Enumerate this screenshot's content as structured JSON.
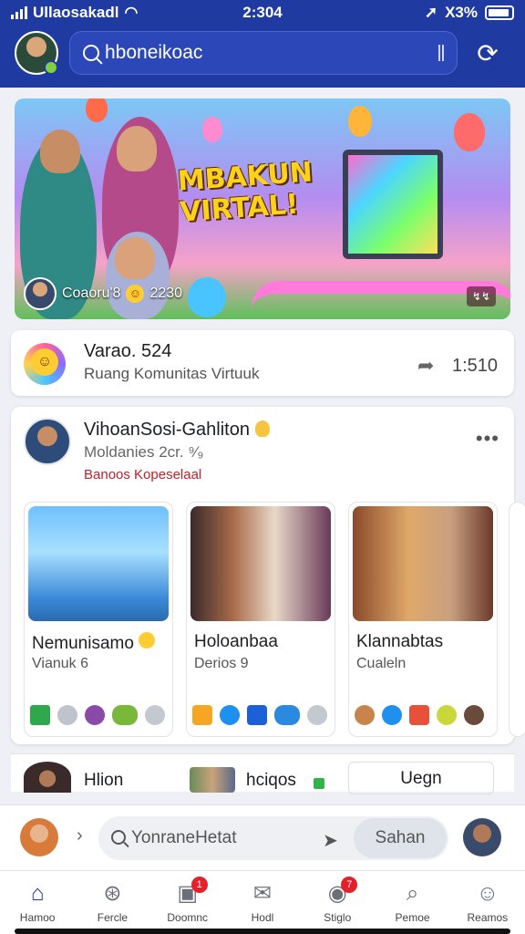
{
  "status": {
    "carrier": "Ullaosakadl",
    "time": "2:304",
    "battery": "X3%"
  },
  "header": {
    "search_text": "hboneikoac"
  },
  "banner": {
    "title": "MBAKUN VIRTAL!",
    "author": "Coaoru'8",
    "count": "2230",
    "badge": "↯↯"
  },
  "community": {
    "title": "Varao. 524",
    "subtitle": "Ruang Komunitas Virtuuk",
    "count": "1:510"
  },
  "post": {
    "author": "VihoanSosi-Gahliton",
    "meta": "Moldanies 2cr. ⁹⁄₉",
    "tag": "Banoos Kopeselaal",
    "cards": [
      {
        "title": "Nemunisamo",
        "subtitle": "Vianuk 6"
      },
      {
        "title": "Holoanbaa",
        "subtitle": "Derios 9"
      },
      {
        "title": "Klannabtas",
        "subtitle": "Cualeln"
      }
    ]
  },
  "strip": {
    "item1": "Hlion",
    "item2": "hciqos",
    "button": "Uegn"
  },
  "composer": {
    "placeholder": "YonraneHetat",
    "button": "Sahan"
  },
  "nav": [
    {
      "label": "Hamoo",
      "icon": "home-icon"
    },
    {
      "label": "Fercle",
      "icon": "explore-icon"
    },
    {
      "label": "Doomnc",
      "icon": "notifications-icon",
      "badge": "1"
    },
    {
      "label": "Hodl",
      "icon": "messages-icon"
    },
    {
      "label": "Stiglo",
      "icon": "chat-icon",
      "badge": "7"
    },
    {
      "label": "Pemoe",
      "icon": "search-icon"
    },
    {
      "label": "Reamos",
      "icon": "profile-icon"
    }
  ],
  "colors": {
    "brand": "#1f3aa0",
    "badge": "#e4202a",
    "tag": "#c0202a"
  }
}
